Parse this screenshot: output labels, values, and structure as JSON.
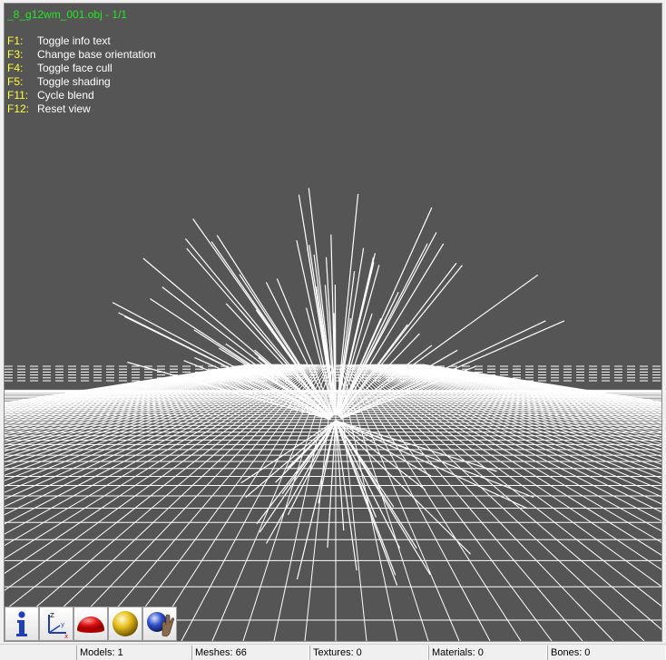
{
  "viewport": {
    "title": "_8_g12wm_001.obj - 1/1",
    "help": [
      {
        "key": "F1:",
        "text": "Toggle info text"
      },
      {
        "key": "F3:",
        "text": "Change base orientation"
      },
      {
        "key": "F4:",
        "text": "Toggle face cull"
      },
      {
        "key": "F5:",
        "text": "Toggle shading"
      },
      {
        "key": "F11:",
        "text": "Cycle blend"
      },
      {
        "key": "F12:",
        "text": "Reset view"
      }
    ]
  },
  "toolbar": {
    "buttons": [
      {
        "icon": "info-icon"
      },
      {
        "icon": "axes-icon"
      },
      {
        "icon": "red-hemisphere-icon"
      },
      {
        "icon": "yellow-sphere-icon"
      },
      {
        "icon": "sphere-hand-icon"
      }
    ]
  },
  "status": {
    "models": "Models: 1",
    "meshes": "Meshes: 66",
    "textures": "Textures: 0",
    "materials": "Materials: 0",
    "bones": "Bones: 0"
  },
  "colors": {
    "viewport_bg": "#555555",
    "grid": "#ffffff",
    "title": "#23e823",
    "help_key": "#ffff33",
    "help_text": "#ffffff"
  }
}
